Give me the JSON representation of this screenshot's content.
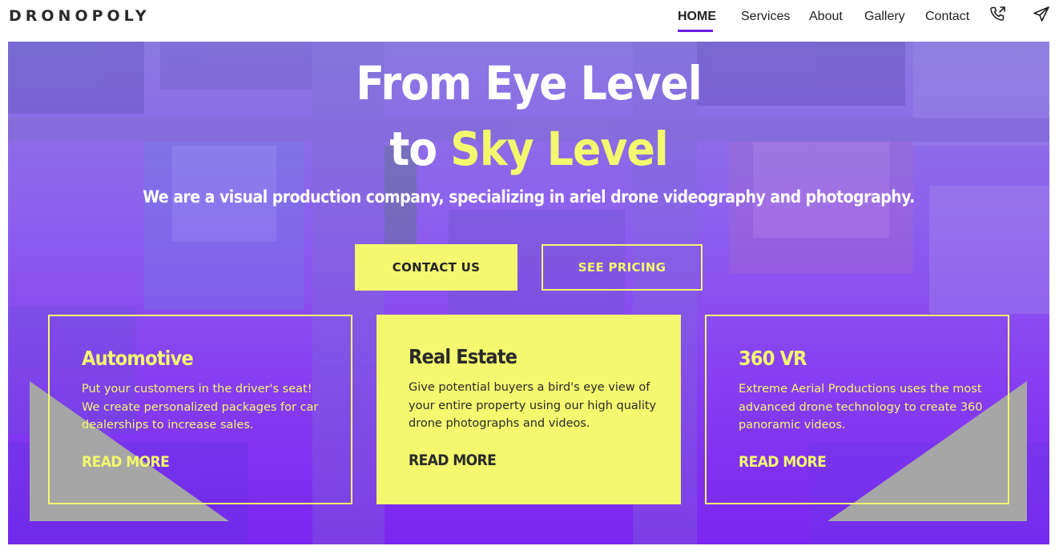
{
  "brand": "DRONOPOLY",
  "nav": {
    "items": [
      {
        "label": "HOME",
        "active": true
      },
      {
        "label": "Services"
      },
      {
        "label": "About"
      },
      {
        "label": "Gallery"
      },
      {
        "label": "Contact"
      }
    ],
    "icons": [
      "phone-icon",
      "send-icon"
    ]
  },
  "hero": {
    "title_line1": "From Eye Level",
    "title_line2_prefix": "to ",
    "title_line2_highlight": "Sky Level",
    "subtitle": "We are a visual production company, specializing in ariel drone videography and photography.",
    "buttons": {
      "contact": "CONTACT US",
      "pricing": "SEE PRICING"
    }
  },
  "cards": [
    {
      "title": "Automotive",
      "text": "Put your customers in the driver's seat! We create personalized packages for car dealerships to increase sales.",
      "link": "READ MORE",
      "style": "outline"
    },
    {
      "title": "Real Estate",
      "text": "Give potential buyers a bird's eye view of your entire property using our high quality drone photographs and videos.",
      "link": "READ MORE",
      "style": "solid"
    },
    {
      "title": "360 VR",
      "text": "Extreme Aerial Productions uses the most advanced drone technology to create 360 panoramic videos.",
      "link": "READ MORE",
      "style": "outline"
    }
  ],
  "colors": {
    "accent": "#f3f86e",
    "purple": "#7b25f0",
    "nav_underline": "#6a1fe0",
    "decor_gray": "#a6a6a6"
  }
}
